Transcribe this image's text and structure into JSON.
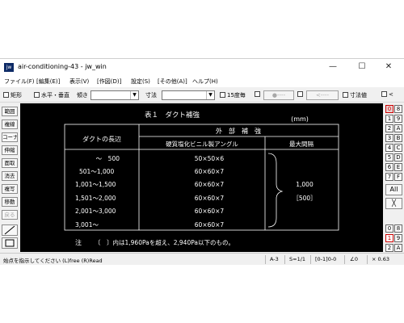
{
  "window": {
    "icon_text": "jw",
    "title": "air-conditioning-43 - jw_win",
    "controls": {
      "minimize": "—",
      "maximize": "☐",
      "close": "✕"
    }
  },
  "menu": [
    "ファイル(F)",
    "[編集(E)]",
    "表示(V)",
    "[作図(D)]",
    "設定(S)",
    "[その他(A)]",
    "ヘルプ(H)"
  ],
  "toolbar": {
    "rect": "矩形",
    "horiz_vert": "水平・垂直",
    "tilt": "傾き",
    "dim": "寸法",
    "every15": "15度毎",
    "btn_circle": "●----",
    "btn_arrows": "<----",
    "dim_value": "寸法値",
    "last": "<"
  },
  "left_tools": [
    "範囲",
    "複線",
    "コーナー",
    "伸縮",
    "面取",
    "消去",
    "複写",
    "移動",
    "戻る"
  ],
  "right_tools": {
    "pairs": [
      [
        "0",
        "8"
      ],
      [
        "1",
        "9"
      ],
      [
        "2",
        "A"
      ],
      [
        "3",
        "B"
      ],
      [
        "4",
        "C"
      ],
      [
        "5",
        "D"
      ],
      [
        "6",
        "E"
      ],
      [
        "7",
        "F"
      ]
    ],
    "all": "All",
    "cross": "╳",
    "bottom": [
      [
        "0",
        "8"
      ],
      [
        "1",
        "9"
      ],
      [
        "2",
        "A"
      ]
    ]
  },
  "drawing": {
    "title": "表１　ダクト補強",
    "unit": "(mm)",
    "header": {
      "side_length": "ダクトの長辺",
      "reinforcement": "外　部　補　強",
      "angle": "硬質塩化ビニル製アングル",
      "max_interval": "最大間隔"
    },
    "rows": [
      {
        "range": "～　500",
        "angle": "50×50×6"
      },
      {
        "range": "501～1,000",
        "angle": "60×60×7"
      },
      {
        "range": "1,001～1,500",
        "angle": "60×60×7"
      },
      {
        "range": "1,501～2,000",
        "angle": "60×60×7"
      },
      {
        "range": "2,001～3,000",
        "angle": "60×60×7"
      },
      {
        "range": "3,001～",
        "angle": "60×60×7"
      }
    ],
    "interval_value": "1,000",
    "interval_paren": "［500］",
    "note_label": "注",
    "note_text": "〔　〕内は1,960Paを超え、2,940Pa以下のもの。"
  },
  "status": {
    "message": "始点を指示してください (L)free (R)Read",
    "paper": "A-3",
    "scale": "S=1/1",
    "layer": "[0-1]0-0",
    "angle": "∠0",
    "zoom": "× 0.63"
  },
  "colors": {
    "canvas_bg": "#000000",
    "drawing_line": "#ffffff",
    "active_layer": "#cc0000"
  }
}
